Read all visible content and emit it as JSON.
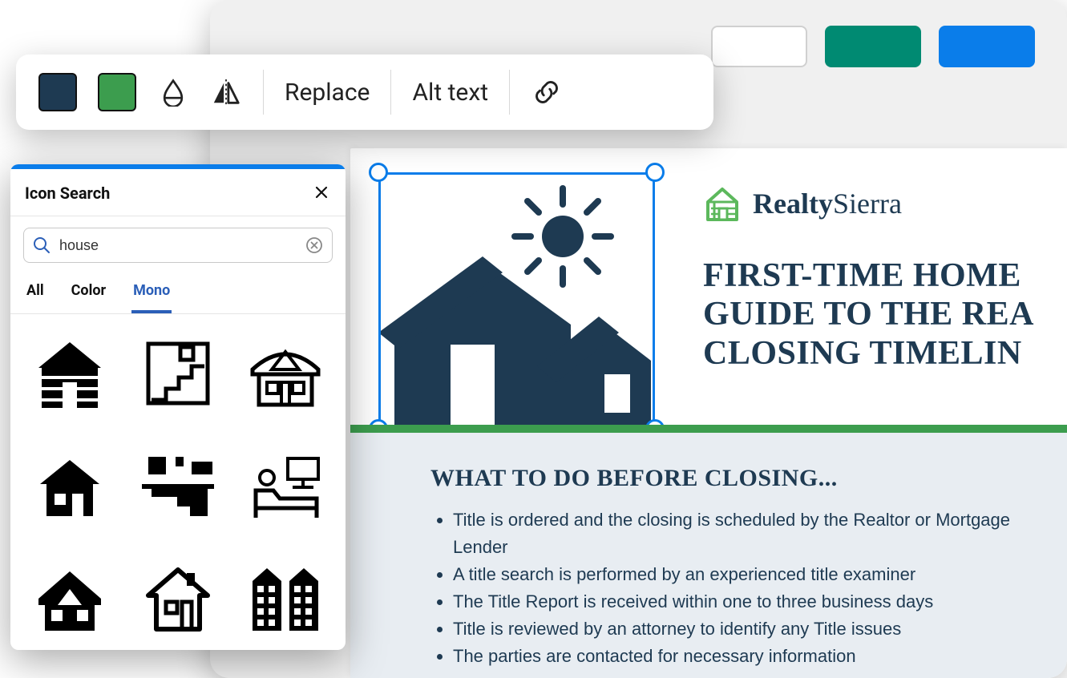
{
  "topbar": {
    "outline_button": "",
    "teal_button": "",
    "blue_button": ""
  },
  "toolbar": {
    "swatch1_color": "#1e3a52",
    "swatch2_color": "#3c9d4e",
    "replace_label": "Replace",
    "alt_text_label": "Alt text",
    "opacity_icon": "opacity-icon",
    "flip_icon": "flip-icon",
    "link_icon": "link-icon"
  },
  "icon_panel": {
    "title": "Icon Search",
    "search_value": "house",
    "tabs": {
      "all": "All",
      "color": "Color",
      "mono": "Mono"
    },
    "active_tab": "Mono",
    "results": [
      "log-cabin-icon",
      "stairs-house-icon",
      "cottage-icon",
      "small-house-icon",
      "split-stairs-icon",
      "bedroom-icon",
      "roof-house-icon",
      "house-outline-icon",
      "apartments-icon"
    ]
  },
  "document": {
    "brand_strong": "Realty",
    "brand_light": "Sierra",
    "headline_l1": "FIRST-TIME HOME",
    "headline_l2": "GUIDE TO THE REA",
    "headline_l3": "CLOSING TIMELIN",
    "section_title": "WHAT TO DO BEFORE CLOSING...",
    "bullets": [
      "Title is ordered and the closing is scheduled by the Realtor or Mortgage Lender",
      "A title search is performed by an experienced title examiner",
      "The Title Report is received within one to three business days",
      "Title is reviewed by an attorney  to identify any Title issues",
      "The parties are contacted for necessary information"
    ]
  }
}
